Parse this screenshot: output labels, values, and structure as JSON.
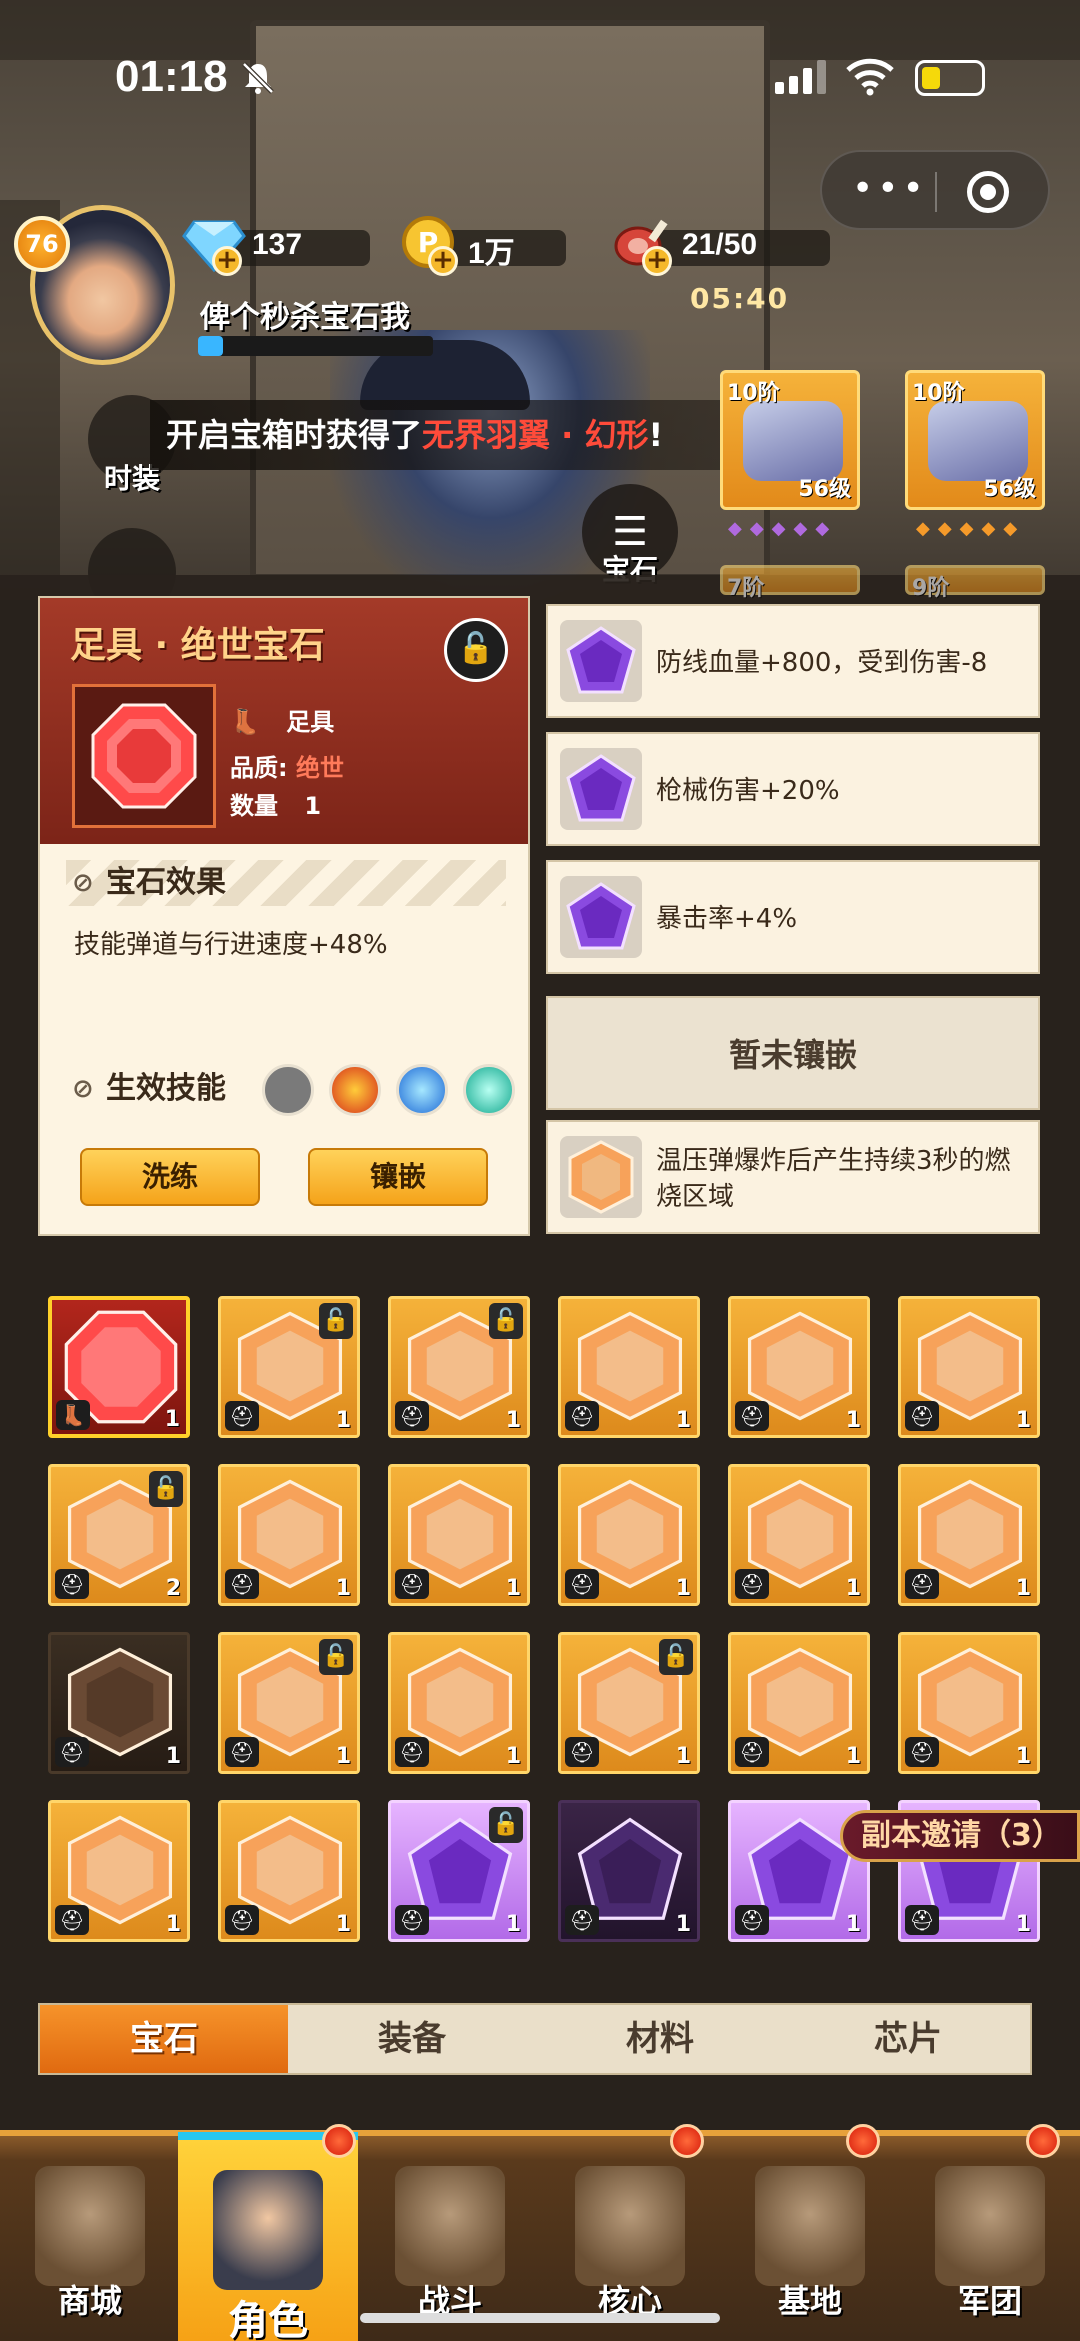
{
  "status_bar": {
    "time": "01:18"
  },
  "player": {
    "level": "76",
    "name": "俾个秒杀宝石我",
    "diamonds": "137",
    "gold": "1万",
    "stamina": "21/50",
    "stamina_timer": "05:40"
  },
  "side_buttons": {
    "fashion": "时装"
  },
  "notice": {
    "prefix": "开启宝箱时获得了",
    "highlight": "无界羽翼 · 幻形",
    "suffix": "!"
  },
  "gem_menu_label": "宝石",
  "equip_slots": [
    {
      "tier": "10阶",
      "level": "56级"
    },
    {
      "tier": "10阶",
      "level": "56级"
    },
    {
      "tier": "7阶"
    },
    {
      "tier": "9阶"
    }
  ],
  "detail": {
    "title": "足具 · 绝世宝石",
    "slot": "足具",
    "quality_label": "品质:",
    "quality_value": "绝世",
    "count_label": "数量",
    "count_value": "1",
    "effect_header": "宝石效果",
    "effect_text": "技能弹道与行进速度+48%",
    "skill_header": "生效技能",
    "refine_button": "洗练",
    "inlay_button": "镶嵌"
  },
  "effect_cards": [
    {
      "text": "防线血量+800，受到伤害-8",
      "gem": "purple"
    },
    {
      "text": "枪械伤害+20%",
      "gem": "purple"
    },
    {
      "text": "暴击率+4%",
      "gem": "purple"
    },
    {
      "text": "暂未镶嵌",
      "gem": "none"
    },
    {
      "text": "温压弹爆炸后产生持续3秒的燃烧区域",
      "gem": "orange"
    }
  ],
  "gem_grid": [
    [
      {
        "c": "1",
        "t": "sel"
      },
      {
        "c": "1",
        "t": "o",
        "lock": true
      },
      {
        "c": "1",
        "t": "o",
        "lock": true
      },
      {
        "c": "1",
        "t": "o"
      },
      {
        "c": "1",
        "t": "o"
      },
      {
        "c": "1",
        "t": "o"
      }
    ],
    [
      {
        "c": "2",
        "t": "o",
        "lock": true
      },
      {
        "c": "1",
        "t": "o"
      },
      {
        "c": "1",
        "t": "o"
      },
      {
        "c": "1",
        "t": "o"
      },
      {
        "c": "1",
        "t": "o"
      },
      {
        "c": "1",
        "t": "o"
      }
    ],
    [
      {
        "c": "1",
        "t": "dark"
      },
      {
        "c": "1",
        "t": "o",
        "lock": true
      },
      {
        "c": "1",
        "t": "o"
      },
      {
        "c": "1",
        "t": "o",
        "lock": true
      },
      {
        "c": "1",
        "t": "o"
      },
      {
        "c": "1",
        "t": "o"
      }
    ],
    [
      {
        "c": "1",
        "t": "o"
      },
      {
        "c": "1",
        "t": "o"
      },
      {
        "c": "1",
        "t": "p",
        "lock": true
      },
      {
        "c": "1",
        "t": "dp"
      },
      {
        "c": "1",
        "t": "p"
      },
      {
        "c": "1",
        "t": "p"
      }
    ]
  ],
  "invite": "副本邀请（3）",
  "tabs": [
    "宝石",
    "装备",
    "材料",
    "芯片"
  ],
  "bottom_nav": [
    "商城",
    "角色",
    "战斗",
    "核心",
    "基地",
    "军团"
  ],
  "colors": {
    "accent": "#f6932a",
    "highlight": "#ff4b3a",
    "orange_gem": "#f5b23a",
    "purple_gem": "#b26ae8"
  }
}
